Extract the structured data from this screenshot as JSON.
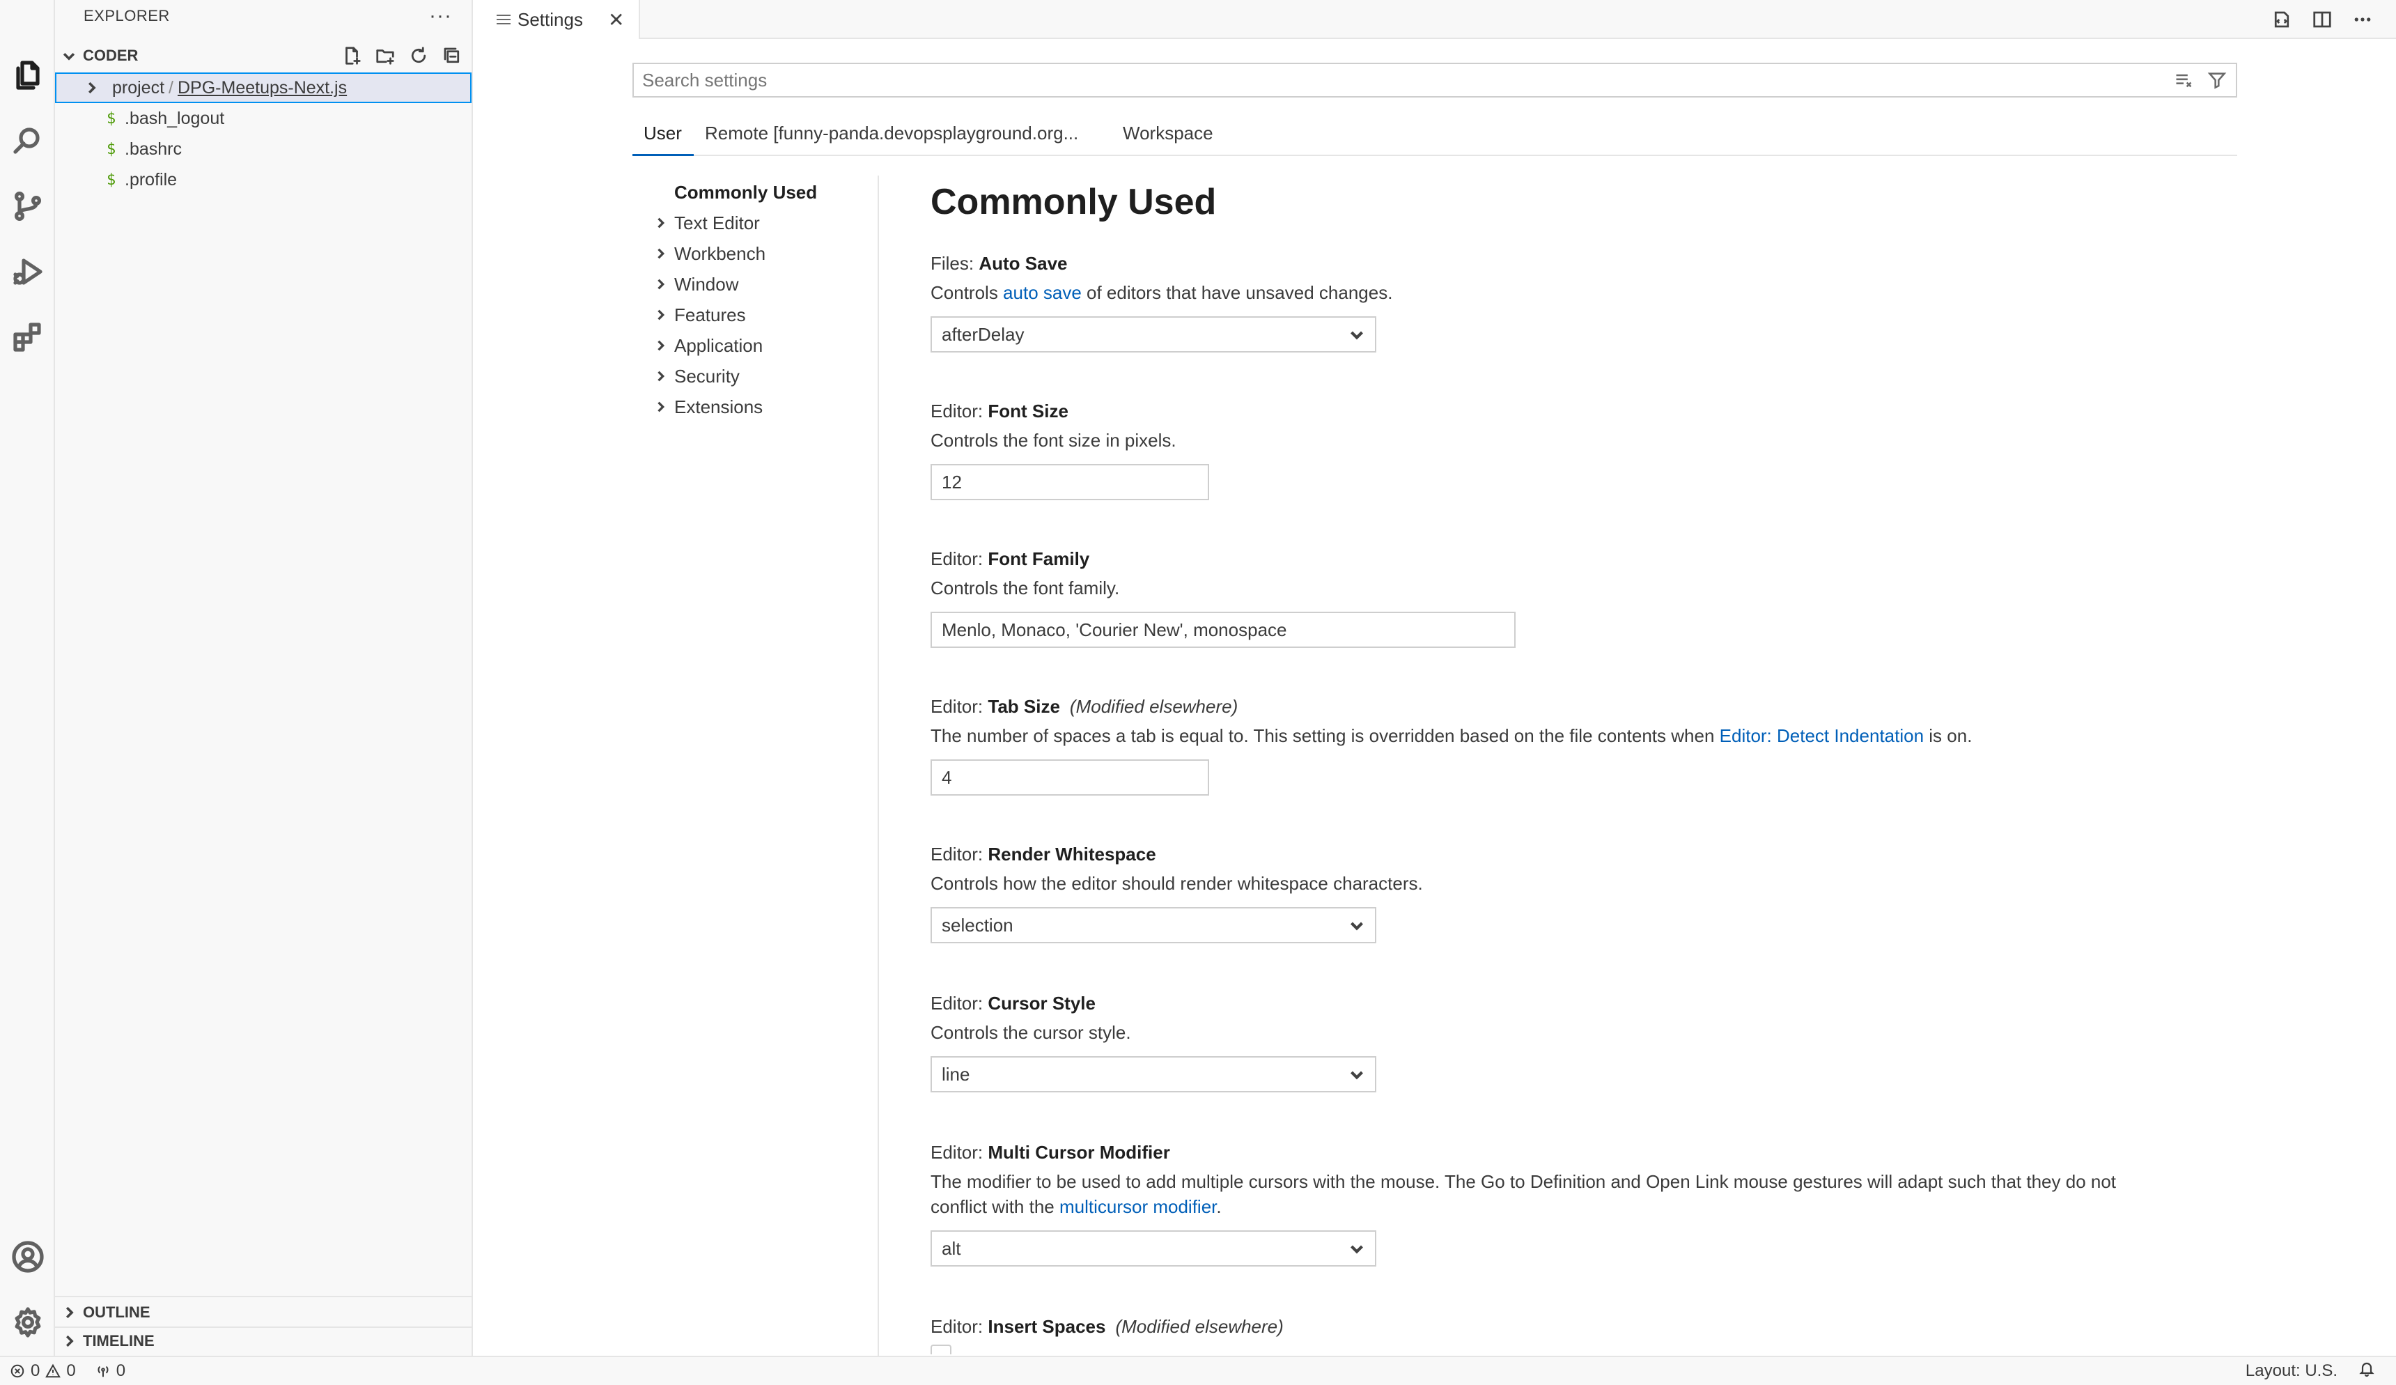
{
  "sidebar": {
    "title": "EXPLORER",
    "more": "···",
    "root": "CODER",
    "tree": [
      {
        "kind": "folder",
        "prefix": "project",
        "name": "DPG-Meetups-Next.js"
      },
      {
        "kind": "file",
        "icon": "$",
        "name": ".bash_logout"
      },
      {
        "kind": "file",
        "icon": "$",
        "name": ".bashrc"
      },
      {
        "kind": "file",
        "icon": "$",
        "name": ".profile"
      }
    ],
    "outline": "OUTLINE",
    "timeline": "TIMELINE"
  },
  "tabs": [
    {
      "label": "Settings",
      "close": "✕"
    }
  ],
  "settings": {
    "search_placeholder": "Search settings",
    "scopes": [
      "User",
      "Remote [funny-panda.devopsplayground.org...",
      "Workspace"
    ],
    "toc": [
      "Commonly Used",
      "Text Editor",
      "Workbench",
      "Window",
      "Features",
      "Application",
      "Security",
      "Extensions"
    ],
    "page_title": "Commonly Used",
    "auto_save": {
      "category": "Files: ",
      "name": "Auto Save",
      "desc_pre": "Controls ",
      "desc_link": "auto save",
      "desc_post": " of editors that have unsaved changes.",
      "value": "afterDelay"
    },
    "font_size": {
      "category": "Editor: ",
      "name": "Font Size",
      "desc": "Controls the font size in pixels.",
      "value": "12"
    },
    "font_family": {
      "category": "Editor: ",
      "name": "Font Family",
      "desc": "Controls the font family.",
      "value": "Menlo, Monaco, 'Courier New', monospace"
    },
    "tab_size": {
      "category": "Editor: ",
      "name": "Tab Size",
      "modified": "(Modified elsewhere)",
      "desc_pre": "The number of spaces a tab is equal to. This setting is overridden based on the file contents when ",
      "desc_link": "Editor: Detect Indentation",
      "desc_post": " is on.",
      "value": "4"
    },
    "render_whitespace": {
      "category": "Editor: ",
      "name": "Render Whitespace",
      "desc": "Controls how the editor should render whitespace characters.",
      "value": "selection"
    },
    "cursor_style": {
      "category": "Editor: ",
      "name": "Cursor Style",
      "desc": "Controls the cursor style.",
      "value": "line"
    },
    "multi_cursor": {
      "category": "Editor: ",
      "name": "Multi Cursor Modifier",
      "desc_line1": "The modifier to be used to add multiple cursors with the mouse. The Go to Definition and Open Link mouse gestures will adapt such that they do not",
      "desc_pre": "conflict with the ",
      "desc_link": "multicursor modifier",
      "desc_post": ".",
      "value": "alt"
    },
    "insert_spaces": {
      "category": "Editor: ",
      "name": "Insert Spaces",
      "modified": "(Modified elsewhere)"
    }
  },
  "statusbar": {
    "errors": "0",
    "warnings": "0",
    "ports": "0",
    "layout": "Layout: U.S."
  },
  "colors": {
    "accent": "#005fb8",
    "selection_border": "#0090f1",
    "shell_icon": "#4d9a06"
  }
}
